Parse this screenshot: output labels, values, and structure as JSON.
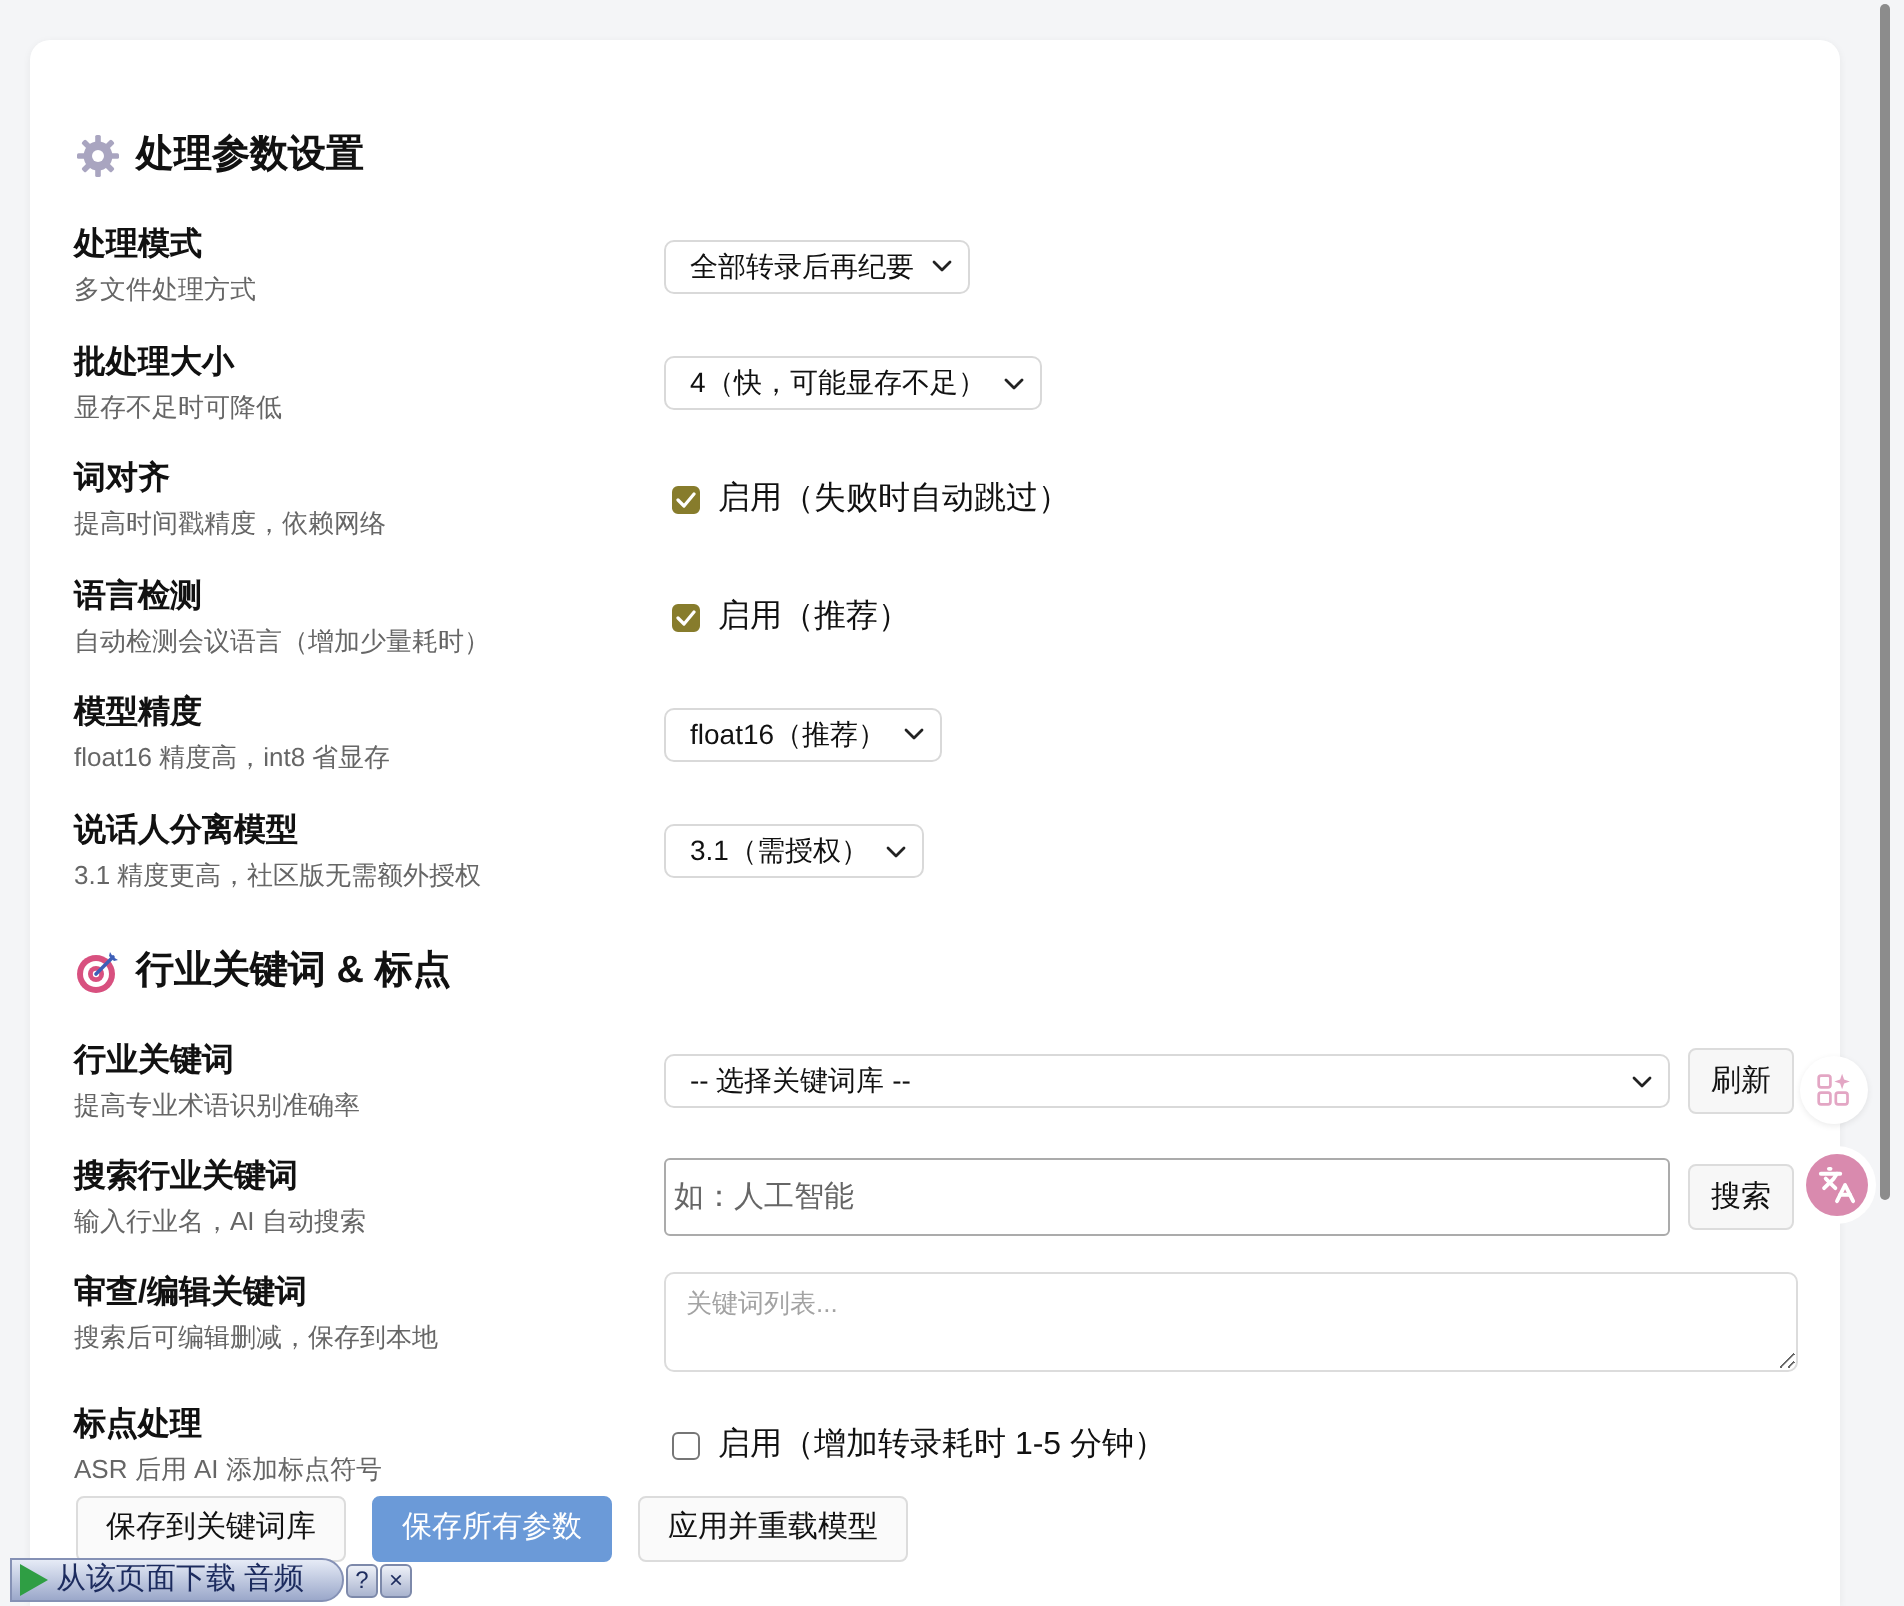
{
  "sections": [
    {
      "title": "处理参数设置",
      "rows": [
        {
          "label": "处理模式",
          "description": "多文件处理方式",
          "kind": "select",
          "value": "全部转录后再纪要"
        },
        {
          "label": "批处理大小",
          "description": "显存不足时可降低",
          "kind": "select",
          "value": "4（快，可能显存不足）"
        },
        {
          "label": "词对齐",
          "description": "提高时间戳精度，依赖网络",
          "kind": "checkbox",
          "checked": true,
          "option": "启用（失败时自动跳过）"
        },
        {
          "label": "语言检测",
          "description": "自动检测会议语言（增加少量耗时）",
          "kind": "checkbox",
          "checked": true,
          "option": "启用（推荐）"
        },
        {
          "label": "模型精度",
          "description": "float16 精度高，int8 省显存",
          "kind": "select",
          "value": "float16（推荐）"
        },
        {
          "label": "说话人分离模型",
          "description": "3.1 精度更高，社区版无需额外授权",
          "kind": "select",
          "value": "3.1（需授权）"
        }
      ]
    },
    {
      "title": "行业关键词 & 标点",
      "rows": [
        {
          "label": "行业关键词",
          "description": "提高专业术语识别准确率",
          "kind": "select_button",
          "value": "-- 选择关键词库 --",
          "button": "刷新"
        },
        {
          "label": "搜索行业关键词",
          "description": "输入行业名，AI 自动搜索",
          "kind": "input_button",
          "placeholder": "如：人工智能",
          "button": "搜索"
        },
        {
          "label": "审查/编辑关键词",
          "description": "搜索后可编辑删减，保存到本地",
          "kind": "textarea",
          "placeholder": "关键词列表..."
        },
        {
          "label": "标点处理",
          "description": "ASR 后用 AI 添加标点符号",
          "kind": "checkbox",
          "checked": false,
          "option": "启用（增加转录耗时 1-5 分钟）"
        }
      ]
    }
  ],
  "actions": [
    {
      "label": "保存到关键词库",
      "primary": false
    },
    {
      "label": "保存所有参数",
      "primary": true
    },
    {
      "label": "应用并重载模型",
      "primary": false
    }
  ],
  "download_bar": {
    "label": "从该页面下载 音频",
    "buttons": [
      "?",
      "×"
    ]
  }
}
